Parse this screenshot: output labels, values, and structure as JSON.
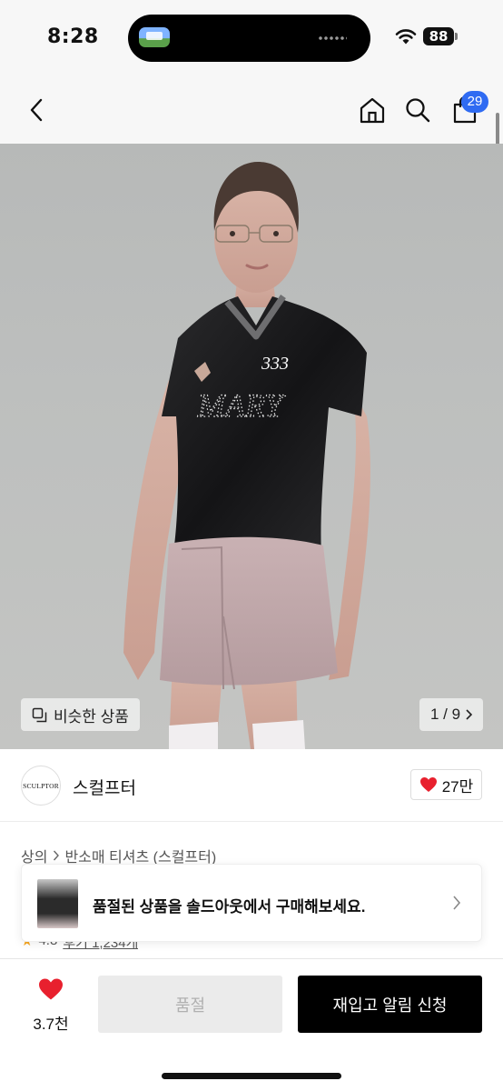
{
  "status_bar": {
    "time": "8:28",
    "battery": "88"
  },
  "nav": {
    "cart_count": "29"
  },
  "hero": {
    "similar_label": "비슷한 상품",
    "pager": "1 / 9",
    "shirt_print_top": "333",
    "shirt_print_main": "MARY"
  },
  "brand": {
    "logo_text": "SCULPTOR",
    "name": "스컬프터",
    "likes": "27만"
  },
  "breadcrumb": {
    "category": "상의",
    "subcategory": "반소매 티셔츠 (스컬프터)"
  },
  "toast": {
    "message": "품절된 상품을 솔드아웃에서 구매해보세요."
  },
  "rating": {
    "score": "4.8",
    "reviews": "후기 1,234개"
  },
  "bottom_bar": {
    "wish_count": "3.7천",
    "soldout_label": "품절",
    "restock_label": "재입고 알림 신청"
  },
  "colors": {
    "accent": "#2f6bf2",
    "heart": "#e8202e",
    "primary_button": "#000000"
  }
}
